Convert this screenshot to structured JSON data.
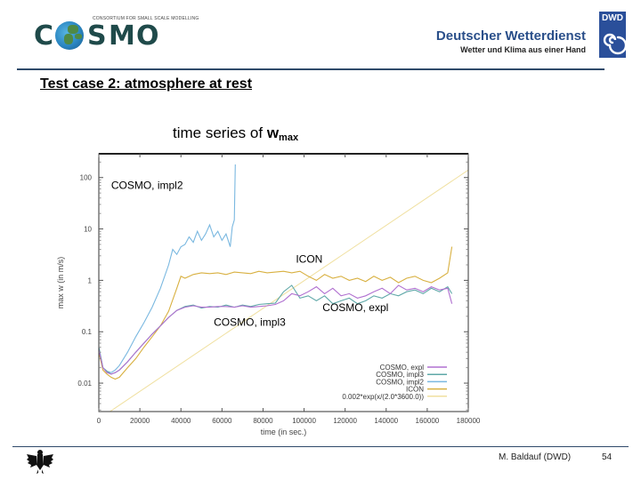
{
  "header": {
    "cosmo_logo": {
      "letters": [
        "C",
        "S",
        "M",
        "O"
      ],
      "subtitle": "CONSORTIUM FOR SMALL SCALE MODELLING",
      "icon": "globe-icon"
    },
    "dwd_logo": {
      "name": "Deutscher Wetterdienst",
      "tagline": "Wetter und Klima aus einer Hand",
      "badge": "DWD",
      "icon": "spiral-icon"
    }
  },
  "slide": {
    "title": "Test case 2: atmosphere at rest",
    "chart_title_main": "time series of ",
    "chart_title_var": "w",
    "chart_title_sub": "max"
  },
  "footer": {
    "author": "M. Baldauf (DWD)",
    "page": "54",
    "emblem": "federal-eagle-icon"
  },
  "chart_data": {
    "type": "line",
    "title": "time series of w_max",
    "xlabel": "time (in sec.)",
    "ylabel": "max w (in m/s)",
    "xlim": [
      0,
      180000
    ],
    "ylim": [
      0.0028,
      290
    ],
    "yscale": "log",
    "grid": false,
    "legend_position": "bottom-right",
    "x_ticks": [
      0,
      20000,
      40000,
      60000,
      80000,
      100000,
      120000,
      140000,
      160000,
      180000
    ],
    "x_tick_labels": [
      "0",
      "20000",
      "40000",
      "60000",
      "80000",
      "100000",
      "120000",
      "140000",
      "160000",
      "180000"
    ],
    "y_ticks": [
      100,
      10,
      1,
      0.1,
      0.01
    ],
    "y_tick_labels": [
      "100",
      "10",
      "1",
      "0.1",
      "0.01"
    ],
    "annotations": [
      {
        "text": "COSMO, impl2",
        "x": 6000,
        "y": 60
      },
      {
        "text": "ICON",
        "x": 96000,
        "y": 2.2
      },
      {
        "text": "COSMO, impl3",
        "x": 56000,
        "y": 0.13
      },
      {
        "text": "COSMO, expl",
        "x": 109000,
        "y": 0.25
      }
    ],
    "series": [
      {
        "name": "COSMO, expl",
        "color": "#b070d0",
        "x": [
          0,
          2000,
          4000,
          6000,
          8000,
          10000,
          14000,
          18000,
          22000,
          26000,
          30000,
          34000,
          38000,
          42000,
          46000,
          50000,
          54000,
          58000,
          62000,
          66000,
          70000,
          74000,
          78000,
          82000,
          86000,
          90000,
          94000,
          98000,
          102000,
          106000,
          110000,
          114000,
          118000,
          122000,
          126000,
          130000,
          134000,
          138000,
          142000,
          146000,
          150000,
          154000,
          158000,
          162000,
          166000,
          170000,
          172000
        ],
        "y": [
          0.045,
          0.02,
          0.016,
          0.015,
          0.016,
          0.018,
          0.026,
          0.04,
          0.06,
          0.09,
          0.13,
          0.19,
          0.26,
          0.3,
          0.32,
          0.3,
          0.3,
          0.31,
          0.31,
          0.3,
          0.32,
          0.3,
          0.31,
          0.32,
          0.34,
          0.4,
          0.55,
          0.5,
          0.6,
          0.75,
          0.55,
          0.7,
          0.5,
          0.55,
          0.45,
          0.5,
          0.6,
          0.7,
          0.55,
          0.8,
          0.65,
          0.7,
          0.6,
          0.75,
          0.65,
          0.7,
          0.35
        ]
      },
      {
        "name": "COSMO, impl3",
        "color": "#5fa8a8",
        "x": [
          0,
          2000,
          4000,
          6000,
          8000,
          10000,
          14000,
          18000,
          22000,
          26000,
          30000,
          34000,
          38000,
          42000,
          46000,
          50000,
          54000,
          58000,
          62000,
          66000,
          70000,
          74000,
          78000,
          82000,
          86000,
          90000,
          94000,
          98000,
          102000,
          106000,
          110000,
          114000,
          118000,
          122000,
          126000,
          130000,
          134000,
          138000,
          142000,
          146000,
          150000,
          154000,
          158000,
          162000,
          166000,
          170000,
          172000
        ],
        "y": [
          0.05,
          0.02,
          0.017,
          0.015,
          0.016,
          0.018,
          0.026,
          0.04,
          0.06,
          0.09,
          0.13,
          0.19,
          0.26,
          0.31,
          0.33,
          0.29,
          0.31,
          0.3,
          0.33,
          0.3,
          0.33,
          0.31,
          0.34,
          0.35,
          0.36,
          0.6,
          0.8,
          0.45,
          0.5,
          0.4,
          0.5,
          0.35,
          0.4,
          0.45,
          0.35,
          0.4,
          0.5,
          0.45,
          0.55,
          0.5,
          0.6,
          0.65,
          0.55,
          0.7,
          0.6,
          0.75,
          0.55
        ]
      },
      {
        "name": "COSMO, impl2",
        "color": "#7ab8e0",
        "x": [
          0,
          2000,
          4000,
          6000,
          8000,
          10000,
          14000,
          18000,
          22000,
          26000,
          30000,
          34000,
          36000,
          38000,
          40000,
          42000,
          44000,
          46000,
          48000,
          50000,
          52000,
          54000,
          56000,
          58000,
          60000,
          62000,
          64000,
          65000,
          66000,
          66500
        ],
        "y": [
          0.05,
          0.02,
          0.017,
          0.016,
          0.018,
          0.022,
          0.04,
          0.08,
          0.15,
          0.3,
          0.7,
          2.0,
          4.0,
          3.2,
          4.5,
          5.0,
          7.0,
          5.5,
          9.0,
          6.0,
          8.0,
          12.0,
          7.0,
          9.0,
          6.0,
          8.0,
          4.5,
          11.0,
          15.0,
          180.0
        ]
      },
      {
        "name": "ICON",
        "color": "#d8b040",
        "x": [
          0,
          2000,
          4000,
          6000,
          8000,
          10000,
          14000,
          18000,
          22000,
          26000,
          30000,
          34000,
          38000,
          40000,
          42000,
          46000,
          50000,
          54000,
          58000,
          62000,
          66000,
          70000,
          74000,
          78000,
          82000,
          86000,
          90000,
          94000,
          98000,
          102000,
          106000,
          110000,
          114000,
          118000,
          122000,
          126000,
          130000,
          134000,
          138000,
          142000,
          146000,
          150000,
          154000,
          158000,
          162000,
          166000,
          170000,
          172000
        ],
        "y": [
          0.04,
          0.018,
          0.015,
          0.013,
          0.012,
          0.013,
          0.02,
          0.03,
          0.05,
          0.08,
          0.13,
          0.25,
          0.7,
          1.2,
          1.1,
          1.3,
          1.4,
          1.35,
          1.4,
          1.3,
          1.45,
          1.4,
          1.35,
          1.5,
          1.4,
          1.45,
          1.5,
          1.4,
          1.5,
          1.2,
          1.0,
          1.3,
          1.1,
          1.2,
          1.0,
          1.1,
          0.95,
          1.2,
          1.0,
          1.15,
          0.9,
          1.1,
          1.2,
          1.0,
          0.9,
          1.1,
          1.4,
          4.5
        ]
      },
      {
        "name": "0.002*exp(x/(2.0*3600.0))",
        "color": "#f0e0a0",
        "function": "0.002*exp(x/7200)",
        "x": [
          0,
          180000
        ],
        "y": [
          0.002,
          140
        ]
      }
    ]
  }
}
